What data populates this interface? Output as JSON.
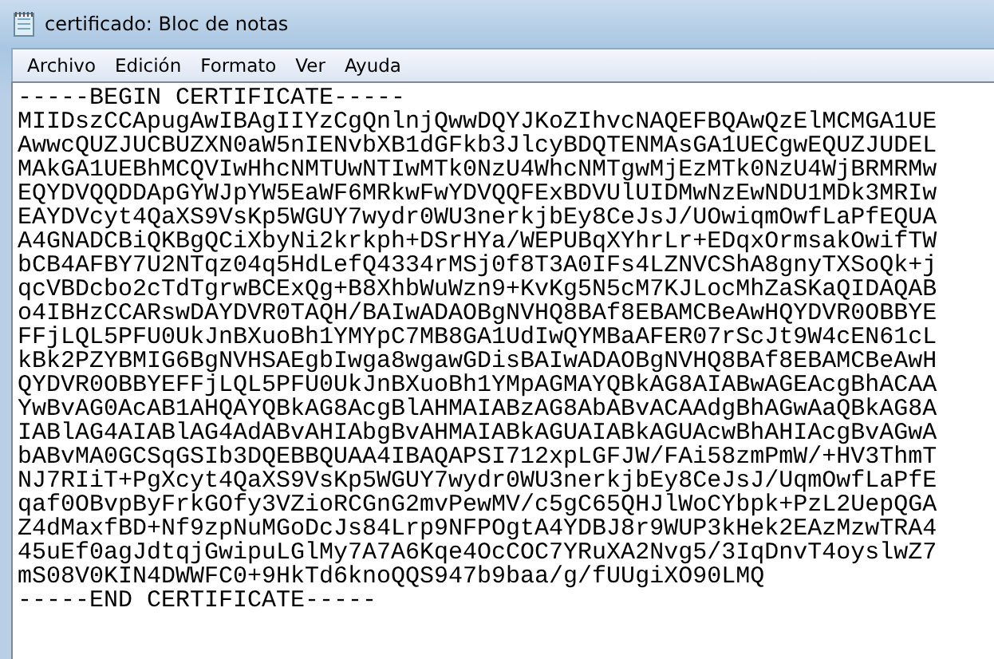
{
  "window": {
    "title": "certificado: Bloc de notas"
  },
  "menu": [
    {
      "label": "Archivo"
    },
    {
      "label": "Edición"
    },
    {
      "label": "Formato"
    },
    {
      "label": "Ver"
    },
    {
      "label": "Ayuda"
    }
  ],
  "editor": {
    "lines": [
      "-----BEGIN CERTIFICATE-----",
      "MIIDszCCApugAwIBAgIIYzCgQnlnjQwwDQYJKoZIhvcNAQEFBQAwQzElMCMGA1UE",
      "AwwcQUZJUCBUZXN0aW5nIENvbXB1dGFkb3JlcyBDQTENMAsGA1UECgwEQUZJUDEL",
      "MAkGA1UEBhMCQVIwHhcNMTUwNTIwMTk0NzU4WhcNMTgwMjEzMTk0NzU4WjBRMRMw",
      "EQYDVQQDDApGYWJpYW5EaWF6MRkwFwYDVQQFExBDVUlUIDMwNzEwNDU1MDk3MRIw",
      "EAYDVcyt4QaXS9VsKp5WGUY7wydr0WU3nerkjbEy8CeJsJ/UOwiqmOwfLaPfEQUA",
      "A4GNADCBiQKBgQCiXbyNi2krkph+DSrHYa/WEPUBqXYhrLr+EDqxOrmsakOwifTW",
      "bCB4AFBY7U2NTqz04q5HdLefQ4334rMSj0f8T3A0IFs4LZNVCShA8gnyTXSoQk+j",
      "qcVBDcbo2cTdTgrwBCExQg+B8XhbWuWzn9+KvKg5N5cM7KJLocMhZaSKaQIDAQAB",
      "o4IBHzCCARswDAYDVR0TAQH/BAIwADAOBgNVHQ8BAf8EBAMCBeAwHQYDVR0OBBYE",
      "FFjLQL5PFU0UkJnBXuoBh1YMYpC7MB8GA1UdIwQYMBaAFER07rScJt9W4cEN61cL",
      "kBk2PZYBMIG6BgNVHSAEgbIwga8wgawGDisBAIwADAOBgNVHQ8BAf8EBAMCBeAwH",
      "QYDVR0OBBYEFFjLQL5PFU0UkJnBXuoBh1YMpAGMAYQBkAG8AIABwAGEAcgBhACAA",
      "YwBvAG0AcAB1AHQAYQBkAG8AcgBlAHMAIABzAG8AbABvACAAdgBhAGwAaQBkAG8A",
      "IABlAG4AIABlAG4AdABvAHIAbgBvAHMAIABkAGUAIABkAGUAcwBhAHIAcgBvAGwA",
      "bABvMA0GCSqGSIb3DQEBBQUAA4IBAQAPSI712xpLGFJW/FAi58zmPmW/+HV3ThmT",
      "NJ7RIiT+PgXcyt4QaXS9VsKp5WGUY7wydr0WU3nerkjbEy8CeJsJ/UqmOwfLaPfE",
      "qaf0OBvpByFrkGOfy3VZioRCGnG2mvPewMV/c5gC65QHJlWoCYbpk+PzL2UepQGA",
      "Z4dMaxfBD+Nf9zpNuMGoDcJs84Lrp9NFPOgtA4YDBJ8r9WUP3kHek2EAzMzwTRA4",
      "45uEf0agJdtqjGwipuLGlMy7A7A6Kqe4OcCOC7YRuXA2Nvg5/3IqDnvT4oyslwZ7",
      "mS08V0KIN4DWWFC0+9HkTd6knoQQS947b9baa/g/fUUgiXO90LMQ",
      "-----END CERTIFICATE-----"
    ]
  }
}
